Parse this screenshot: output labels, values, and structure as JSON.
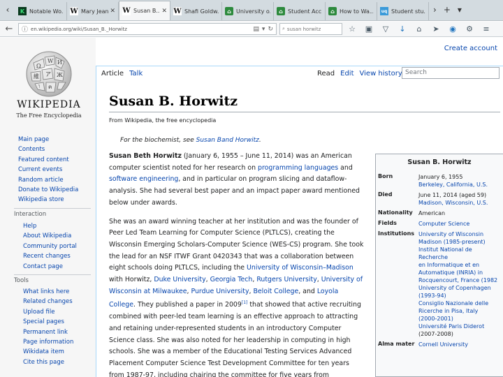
{
  "browser": {
    "tabs": [
      {
        "icon": "K",
        "title": "Notable Wo..."
      },
      {
        "icon": "W",
        "title": "Mary Jean ..."
      },
      {
        "icon": "W",
        "title": "Susan B..."
      },
      {
        "icon": "W",
        "title": "Shafi Goldw..."
      },
      {
        "icon": "U",
        "title": "University o..."
      },
      {
        "icon": "S",
        "title": "Student Acc..."
      },
      {
        "icon": "H",
        "title": "How to Wa..."
      },
      {
        "icon": "uq",
        "title": "Student stu..."
      }
    ],
    "url": "en.wikipedia.org/wiki/Susan_B._Horwitz",
    "search": "susan horwitz"
  },
  "page": {
    "create_account": "Create account",
    "wordmark": "WIKIPEDIA",
    "tagline": "The Free Encyclopedia",
    "nav": [
      "Main page",
      "Contents",
      "Featured content",
      "Current events",
      "Random article",
      "Donate to Wikipedia",
      "Wikipedia store"
    ],
    "interaction_head": "Interaction",
    "interaction": [
      "Help",
      "About Wikipedia",
      "Community portal",
      "Recent changes",
      "Contact page"
    ],
    "tools_head": "Tools",
    "tools": [
      "What links here",
      "Related changes",
      "Upload file",
      "Special pages",
      "Permanent link",
      "Page information",
      "Wikidata item",
      "Cite this page"
    ],
    "tab_article": "Article",
    "tab_talk": "Talk",
    "tab_read": "Read",
    "tab_edit": "Edit",
    "tab_history": "View history",
    "search_placeholder": "Search",
    "title": "Susan B. Horwitz",
    "from": "From Wikipedia, the free encyclopedia",
    "hatnote_prefix": "For the biochemist, see ",
    "hatnote_link": "Susan Band Horwitz",
    "hatnote_suffix": ".",
    "p1": {
      "name": "Susan Beth Horwitz",
      "t1": " (January 6, 1955 – June 11, 2014) was an American computer scientist noted for her research on ",
      "l1": "programming languages",
      "t2": " and ",
      "l2": "software engineering",
      "t3": ", and in particular on program slicing and dataflow-analysis. She had several best paper and an impact paper award mentioned below under awards."
    },
    "p2": {
      "t1": "She was an award winning teacher at her institution and was the founder of Peer Led Team Learning for Computer Science (PLTLCS), creating the Wisconsin Emerging Scholars-Computer Science (WES-CS) program. She took the lead for an NSF ITWF Grant 0420343 that was a collaboration between eight schools doing PLTLCS, including the ",
      "l1": "University of Wisconsin–Madison",
      "t2": " with Horwitz, ",
      "l2": "Duke University",
      "t3": ", ",
      "l3": "Georgia Tech",
      "t4": ", ",
      "l4": "Rutgers University",
      "t5": ", ",
      "l5": "University of Wisconsin at Milwaukee",
      "t6": ", ",
      "l6": "Purdue University",
      "t7": ", ",
      "l7": "Beloit College",
      "t8": ", and ",
      "l8": "Loyola College",
      "t9": ". They published a paper in 2009",
      "ref": "[1]",
      "t10": " that showed that active recruiting combined with peer-led team learning is an effective approach to attracting and retaining under-represented students in an introductory Computer Science class. She was also noted for her leadership in computing in high schools. She was a member of the Educational Testing Services Advanced Placement Computer Science Test Development Committee for ten years from 1987-97, including chairing the committee for five years from"
    },
    "infobox": {
      "title": "Susan B. Horwitz",
      "born_label": "Born",
      "born_date": "January 6, 1955",
      "born_place": "Berkeley, California, U.S.",
      "died_label": "Died",
      "died_date": "June 11, 2014 (aged 59)",
      "died_place": "Madison, Wisconsin, U.S.",
      "nationality_label": "Nationality",
      "nationality": "American",
      "fields_label": "Fields",
      "fields": "Computer Science",
      "institutions_label": "Institutions",
      "institutions": [
        "University of Wisconsin",
        "Madison (1985-present)",
        "Institut National de Recherche",
        "en Informatique et en",
        "Automatique (INRIA) in",
        "Rocquencourt, France (1982",
        "University of Copenhagen",
        "(1993-94)",
        "Consiglio Nazionale delle",
        "Ricerche in Pisa, Italy",
        "(2000-2001)",
        "Université Paris Diderot",
        "(2007-2008)"
      ],
      "alma_label": "Alma mater",
      "alma": "Cornell University"
    }
  }
}
